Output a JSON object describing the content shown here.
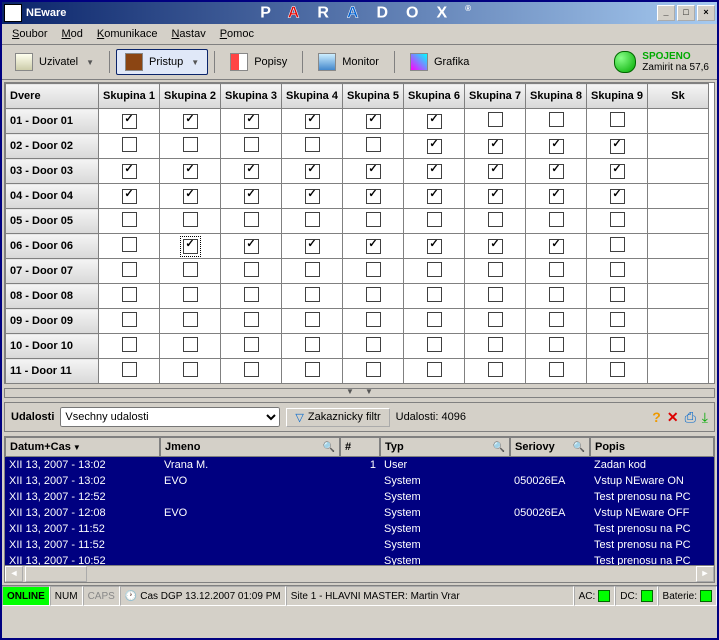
{
  "window": {
    "title": "NEware"
  },
  "brand_letters": "PARADOX",
  "menu": [
    {
      "label": "Soubor",
      "accel": 0
    },
    {
      "label": "Mod",
      "accel": 0
    },
    {
      "label": "Komunikace",
      "accel": 0
    },
    {
      "label": "Nastav",
      "accel": 0
    },
    {
      "label": "Pomoc",
      "accel": 0
    }
  ],
  "toolbar": {
    "uzivatel": "Uzivatel",
    "pristup": "Pristup",
    "popisy": "Popisy",
    "monitor": "Monitor",
    "grafika": "Grafika"
  },
  "conn": {
    "status": "SPOJENO",
    "sub": "Zamirit na 57,6"
  },
  "grid": {
    "first_header": "Dvere",
    "group_headers": [
      "Skupina 1",
      "Skupina 2",
      "Skupina 3",
      "Skupina 4",
      "Skupina 5",
      "Skupina 6",
      "Skupina 7",
      "Skupina 8",
      "Skupina 9",
      "Sk"
    ],
    "rows": [
      {
        "name": "01 - Door 01",
        "c": [
          true,
          true,
          true,
          true,
          true,
          true,
          false,
          false,
          false
        ]
      },
      {
        "name": "02 - Door 02",
        "c": [
          false,
          false,
          false,
          false,
          false,
          true,
          true,
          true,
          true
        ]
      },
      {
        "name": "03 - Door 03",
        "c": [
          true,
          true,
          true,
          true,
          true,
          true,
          true,
          true,
          true
        ]
      },
      {
        "name": "04 - Door 04",
        "c": [
          true,
          true,
          true,
          true,
          true,
          true,
          true,
          true,
          true
        ]
      },
      {
        "name": "05 - Door 05",
        "c": [
          false,
          false,
          false,
          false,
          false,
          false,
          false,
          false,
          false
        ]
      },
      {
        "name": "06 - Door 06",
        "c": [
          false,
          true,
          true,
          true,
          true,
          true,
          true,
          true,
          false
        ]
      },
      {
        "name": "07 - Door 07",
        "c": [
          false,
          false,
          false,
          false,
          false,
          false,
          false,
          false,
          false
        ]
      },
      {
        "name": "08 - Door 08",
        "c": [
          false,
          false,
          false,
          false,
          false,
          false,
          false,
          false,
          false
        ]
      },
      {
        "name": "09 - Door 09",
        "c": [
          false,
          false,
          false,
          false,
          false,
          false,
          false,
          false,
          false
        ]
      },
      {
        "name": "10 - Door 10",
        "c": [
          false,
          false,
          false,
          false,
          false,
          false,
          false,
          false,
          false
        ]
      },
      {
        "name": "11 - Door 11",
        "c": [
          false,
          false,
          false,
          false,
          false,
          false,
          false,
          false,
          false
        ]
      }
    ],
    "focus": {
      "row": 5,
      "col": 1
    }
  },
  "events": {
    "label": "Udalosti",
    "select_value": "Vsechny udalosti",
    "filter_label": "Zakaznicky filtr",
    "count_label": "Udalosti: 4096",
    "columns": {
      "datumcas": "Datum+Cas",
      "jmeno": "Jmeno",
      "num": "#",
      "typ": "Typ",
      "seriovy": "Seriovy",
      "popis": "Popis"
    },
    "rows": [
      {
        "dt": "XII 13, 2007 - 13:02",
        "jm": "Vrana M.",
        "n": "1",
        "typ": "User",
        "ser": "",
        "pop": "Zadan kod"
      },
      {
        "dt": "XII 13, 2007 - 13:02",
        "jm": "EVO",
        "n": "",
        "typ": "System",
        "ser": "050026EA",
        "pop": "Vstup NEware ON"
      },
      {
        "dt": "XII 13, 2007 - 12:52",
        "jm": "",
        "n": "",
        "typ": "System",
        "ser": "",
        "pop": "Test prenosu na PC"
      },
      {
        "dt": "XII 13, 2007 - 12:08",
        "jm": "EVO",
        "n": "",
        "typ": "System",
        "ser": "050026EA",
        "pop": "Vstup NEware OFF"
      },
      {
        "dt": "XII 13, 2007 - 11:52",
        "jm": "",
        "n": "",
        "typ": "System",
        "ser": "",
        "pop": "Test prenosu na PC"
      },
      {
        "dt": "XII 13, 2007 - 11:52",
        "jm": "",
        "n": "",
        "typ": "System",
        "ser": "",
        "pop": "Test prenosu na PC"
      },
      {
        "dt": "XII 13, 2007 - 10:52",
        "jm": "",
        "n": "",
        "typ": "System",
        "ser": "",
        "pop": "Test prenosu na PC"
      }
    ]
  },
  "status": {
    "online": "ONLINE",
    "num": "NUM",
    "caps": "CAPS",
    "clock": "Cas DGP 13.12.2007  01:09 PM",
    "site": "Site 1 - HLAVNI MASTER: Martin Vrar",
    "ac": "AC:",
    "dc": "DC:",
    "bat": "Baterie:"
  }
}
